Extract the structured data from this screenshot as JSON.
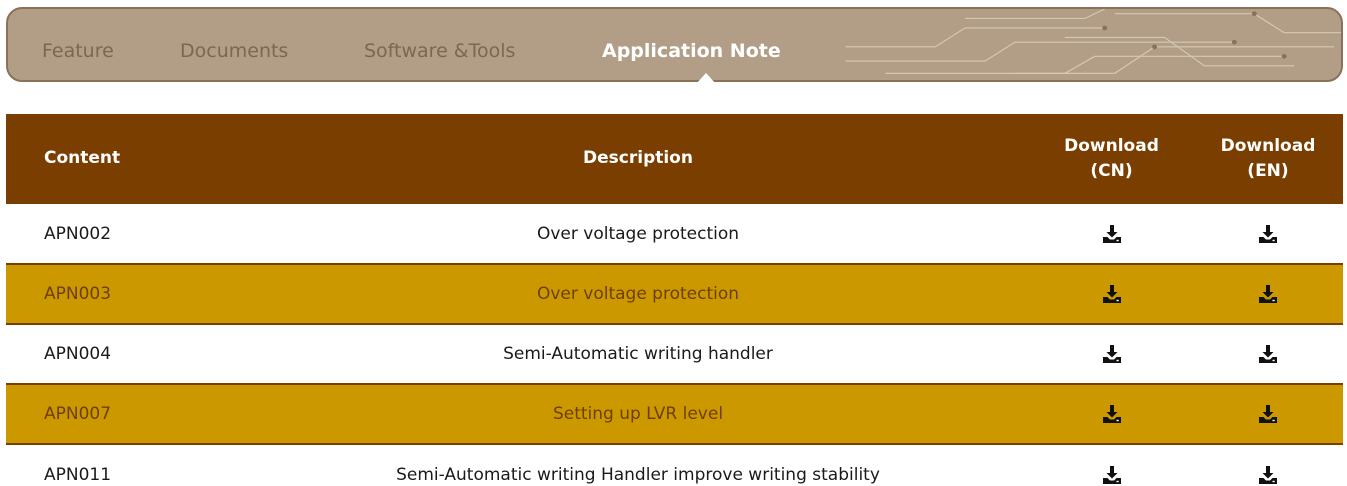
{
  "tabs": [
    {
      "label": "Feature",
      "active": false
    },
    {
      "label": "Documents",
      "active": false
    },
    {
      "label": "Software &Tools",
      "active": false
    },
    {
      "label": "Application Note",
      "active": true
    }
  ],
  "table": {
    "headers": {
      "content": "Content",
      "description": "Description",
      "download_cn_line1": "Download",
      "download_cn_line2": "(CN)",
      "download_en_line1": "Download",
      "download_en_line2": "(EN)"
    },
    "rows": [
      {
        "content": "APN002",
        "description": "Over voltage protection"
      },
      {
        "content": "APN003",
        "description": "Over voltage protection"
      },
      {
        "content": "APN004",
        "description": "Semi-Automatic writing handler"
      },
      {
        "content": "APN007",
        "description": "Setting up LVR level"
      },
      {
        "content": "APN011",
        "description": "Semi-Automatic writing Handler improve writing stability"
      }
    ]
  },
  "icons": {
    "download": "download-icon",
    "tab_pointer": "caret-up-icon"
  },
  "colors": {
    "tab_bar_bg": "#b29e86",
    "tab_inactive_text": "#7b6754",
    "tab_active_text": "#ffffff",
    "header_bg": "#7a3e00",
    "band_bg": "#cc9800",
    "band_text": "#6e3f00"
  }
}
